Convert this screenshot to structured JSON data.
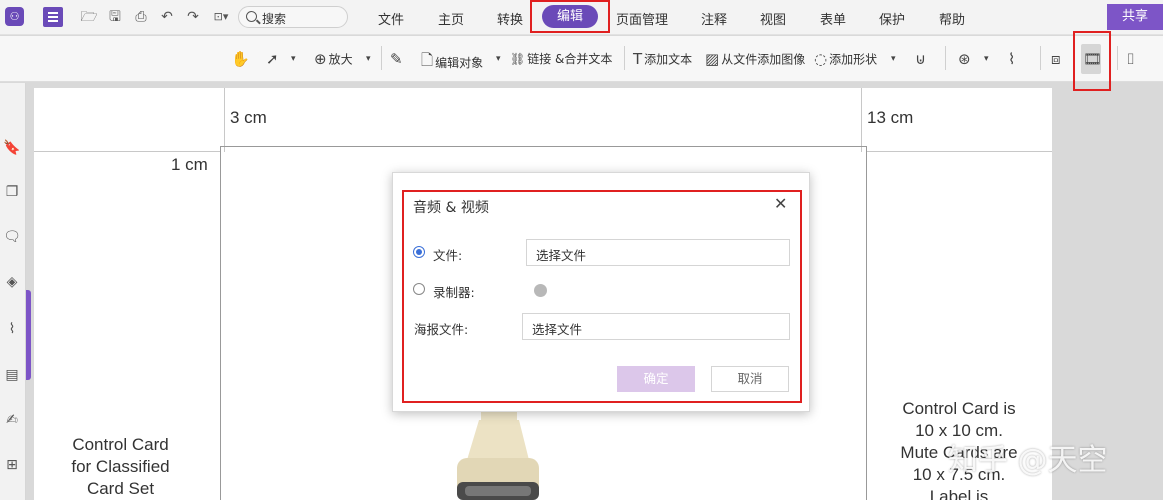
{
  "menu": {
    "search_placeholder": "搜索",
    "tabs": [
      "文件",
      "主页",
      "转换",
      "编辑",
      "页面管理",
      "注释",
      "视图",
      "表单",
      "保护",
      "帮助"
    ],
    "active_tab": "编辑",
    "share_label": "共享"
  },
  "toolbar": {
    "zoom_label": "放大",
    "edit_object_label": "编辑对象",
    "link_merge_label": "链接 &合并文本",
    "add_text_label": "添加文本",
    "add_image_label": "从文件添加图像",
    "add_shape_label": "添加形状"
  },
  "document": {
    "ruler_left": "3 cm",
    "ruler_right": "13 cm",
    "margin_label": "1 cm",
    "left_card_lines": [
      "Control Card",
      "for Classified",
      "Card Set"
    ],
    "right_card_lines": [
      "Control Card is",
      "10 x 10 cm.",
      "Mute Cards are",
      "10 x 7.5 cm.",
      "Label is"
    ]
  },
  "dialog": {
    "title": "音频 & 视频",
    "file_label": "文件:",
    "file_value": "选择文件",
    "recorder_label": "录制器:",
    "poster_label": "海报文件:",
    "poster_value": "选择文件",
    "ok_label": "确定",
    "cancel_label": "取消"
  },
  "watermark": "知乎 @天空",
  "colors": {
    "accent": "#6a4ab8",
    "highlight_box": "#e02020",
    "ok_button": "#dcc7ea"
  }
}
